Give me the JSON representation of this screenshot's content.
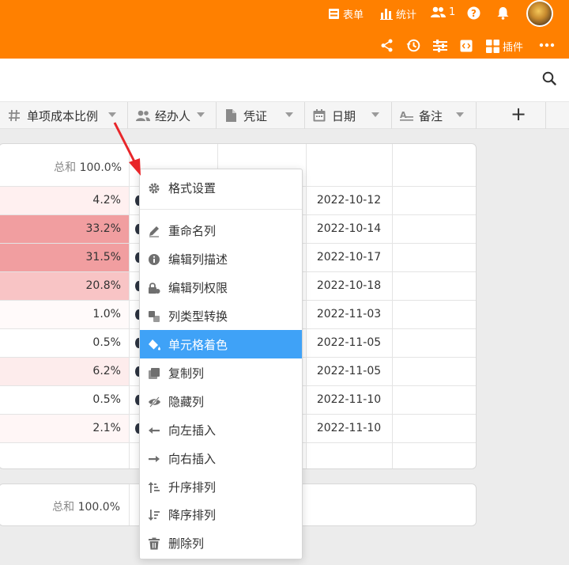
{
  "header": {
    "form_label": "表单",
    "stats_label": "统计",
    "members_count": "1",
    "plugin_label": "插件",
    "bg_color": "#ff8000"
  },
  "columns": [
    {
      "label": "单项成本比例",
      "icon": "hash-icon"
    },
    {
      "label": "经办人",
      "icon": "person-icon"
    },
    {
      "label": "凭证",
      "icon": "file-icon"
    },
    {
      "label": "日期",
      "icon": "calendar-icon"
    },
    {
      "label": "备注",
      "icon": "text-icon"
    }
  ],
  "add_column": "+",
  "summary": {
    "key": "总和",
    "value": "100.0%"
  },
  "rows": [
    {
      "pct": "4.2%",
      "date": "2022-10-12",
      "tint": "#fff0f0"
    },
    {
      "pct": "33.2%",
      "date": "2022-10-14",
      "tint": "#f19ea0"
    },
    {
      "pct": "31.5%",
      "date": "2022-10-17",
      "tint": "#f19ea0"
    },
    {
      "pct": "20.8%",
      "date": "2022-10-18",
      "tint": "#f8c4c5"
    },
    {
      "pct": "1.0%",
      "date": "2022-11-03",
      "tint": "#fffafa"
    },
    {
      "pct": "0.5%",
      "date": "2022-11-05",
      "tint": "#ffffff"
    },
    {
      "pct": "6.2%",
      "date": "2022-11-05",
      "tint": "#fdecec"
    },
    {
      "pct": "0.5%",
      "date": "2022-11-10",
      "tint": "#ffffff"
    },
    {
      "pct": "2.1%",
      "date": "2022-11-10",
      "tint": "#fff6f6"
    }
  ],
  "menu": {
    "items": [
      {
        "label": "格式设置",
        "icon": "gear-icon"
      },
      {
        "label": "重命名列",
        "icon": "pencil-icon"
      },
      {
        "label": "编辑列描述",
        "icon": "info-icon"
      },
      {
        "label": "编辑列权限",
        "icon": "lock-icon"
      },
      {
        "label": "列类型转换",
        "icon": "convert-icon"
      },
      {
        "label": "单元格着色",
        "icon": "paint-bucket-icon",
        "active": true
      },
      {
        "label": "复制列",
        "icon": "copy-icon"
      },
      {
        "label": "隐藏列",
        "icon": "eye-slash-icon"
      },
      {
        "label": "向左插入",
        "icon": "arrow-left-icon"
      },
      {
        "label": "向右插入",
        "icon": "arrow-right-icon"
      },
      {
        "label": "升序排列",
        "icon": "sort-asc-icon"
      },
      {
        "label": "降序排列",
        "icon": "sort-desc-icon"
      },
      {
        "label": "删除列",
        "icon": "trash-icon"
      }
    ],
    "active_color": "#3fa2f7"
  }
}
